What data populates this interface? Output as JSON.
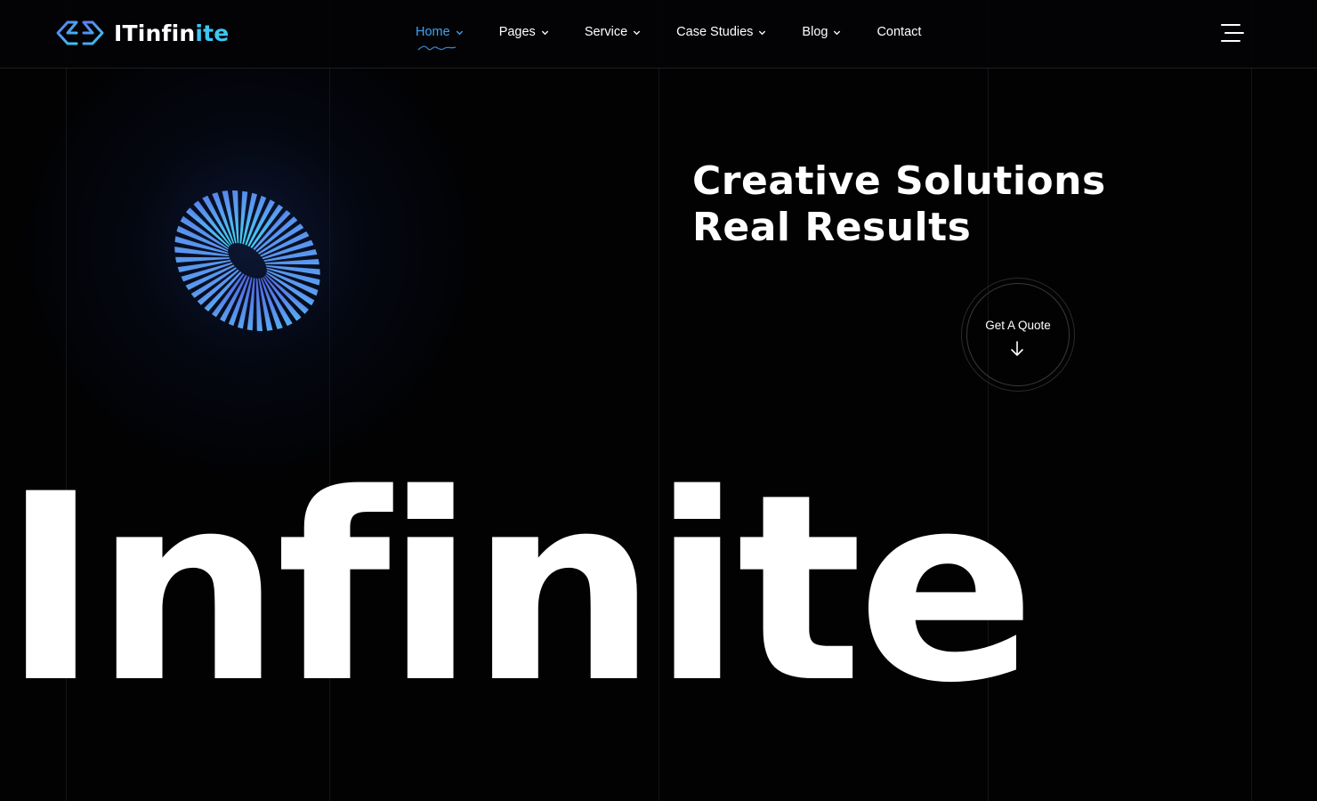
{
  "brand": {
    "name_prefix": "ITinfin",
    "name_accent": "ite",
    "accent_color": "#3ec6f0"
  },
  "nav": {
    "items": [
      {
        "label": "Home",
        "has_dropdown": true,
        "active": true
      },
      {
        "label": "Pages",
        "has_dropdown": true,
        "active": false
      },
      {
        "label": "Service",
        "has_dropdown": true,
        "active": false
      },
      {
        "label": "Case Studies",
        "has_dropdown": true,
        "active": false
      },
      {
        "label": "Blog",
        "has_dropdown": true,
        "active": false
      },
      {
        "label": "Contact",
        "has_dropdown": false,
        "active": false
      }
    ],
    "active_color": "#3fa3f5",
    "menu_icon": "hamburger-icon"
  },
  "hero": {
    "headline_line1": "Creative Solutions",
    "headline_line2": "Real Results",
    "cta_label": "Get A Quote",
    "cta_icon": "arrow-down-icon",
    "big_word": "Infinite",
    "graphic": "striped-torus"
  }
}
